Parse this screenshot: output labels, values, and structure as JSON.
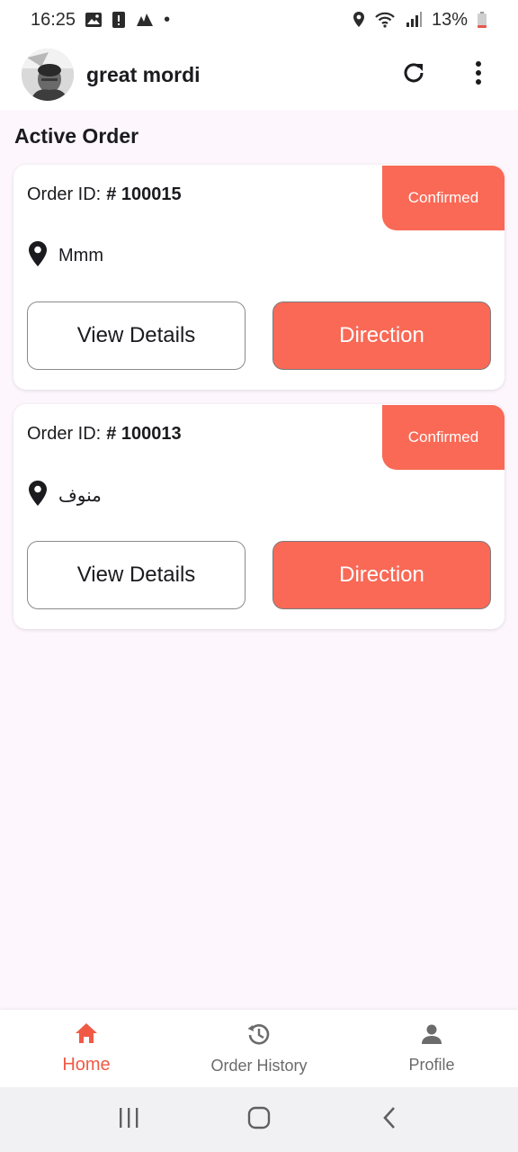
{
  "status_bar": {
    "time": "16:25",
    "dot": "•",
    "battery_percent": "13%",
    "icons_left": [
      "image-icon",
      "alert-icon",
      "activity-icon"
    ],
    "icons_right": [
      "location-icon",
      "wifi-icon",
      "signal-icon",
      "battery-icon"
    ]
  },
  "app_bar": {
    "user_name": "great mordi",
    "actions": [
      "refresh-icon",
      "more-vertical-icon"
    ]
  },
  "section_title": "Active Order",
  "orders": [
    {
      "order_id_label": "Order ID:",
      "order_id_value": "# 100015",
      "status": "Confirmed",
      "address": "Mmm",
      "view_details_label": "View Details",
      "direction_label": "Direction"
    },
    {
      "order_id_label": "Order ID:",
      "order_id_value": "# 100013",
      "status": "Confirmed",
      "address": "منوف",
      "view_details_label": "View Details",
      "direction_label": "Direction"
    }
  ],
  "bottom_nav": {
    "items": [
      {
        "label": "Home",
        "icon": "home-icon",
        "active": true
      },
      {
        "label": "Order History",
        "icon": "history-icon",
        "active": false
      },
      {
        "label": "Profile",
        "icon": "person-icon",
        "active": false
      }
    ]
  },
  "colors": {
    "accent": "#f96956",
    "accent_dark": "#f05a45",
    "background": "#fdf6fd",
    "card": "#ffffff"
  }
}
